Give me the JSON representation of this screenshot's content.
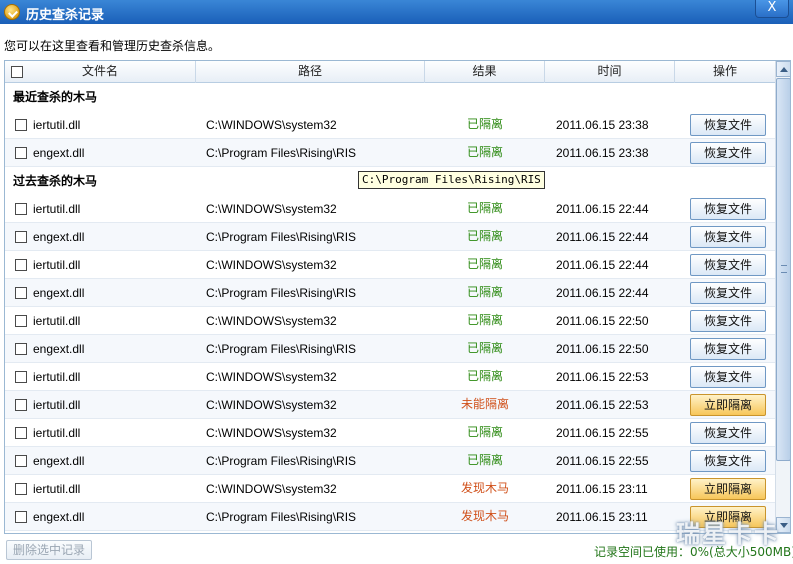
{
  "window": {
    "title": "历史查杀记录",
    "close_label": "X"
  },
  "description": "您可以在这里查看和管理历史查杀信息。",
  "columns": {
    "name": "文件名",
    "path": "路径",
    "result": "结果",
    "time": "时间",
    "action": "操作"
  },
  "groups": [
    {
      "label": "最近查杀的木马",
      "rows": [
        {
          "name": "iertutil.dll",
          "path": "C:\\WINDOWS\\system32",
          "result": "已隔离",
          "result_type": "ok",
          "time": "2011.06.15 23:38",
          "action": "恢复文件",
          "action_type": "restore"
        },
        {
          "name": "engext.dll",
          "path": "C:\\Program Files\\Rising\\RIS",
          "result": "已隔离",
          "result_type": "ok",
          "time": "2011.06.15 23:38",
          "action": "恢复文件",
          "action_type": "restore"
        }
      ]
    },
    {
      "label": "过去查杀的木马",
      "rows": [
        {
          "name": "iertutil.dll",
          "path": "C:\\WINDOWS\\system32",
          "result": "已隔离",
          "result_type": "ok",
          "time": "2011.06.15 22:44",
          "action": "恢复文件",
          "action_type": "restore"
        },
        {
          "name": "engext.dll",
          "path": "C:\\Program Files\\Rising\\RIS",
          "result": "已隔离",
          "result_type": "ok",
          "time": "2011.06.15 22:44",
          "action": "恢复文件",
          "action_type": "restore"
        },
        {
          "name": "iertutil.dll",
          "path": "C:\\WINDOWS\\system32",
          "result": "已隔离",
          "result_type": "ok",
          "time": "2011.06.15 22:44",
          "action": "恢复文件",
          "action_type": "restore"
        },
        {
          "name": "engext.dll",
          "path": "C:\\Program Files\\Rising\\RIS",
          "result": "已隔离",
          "result_type": "ok",
          "time": "2011.06.15 22:44",
          "action": "恢复文件",
          "action_type": "restore"
        },
        {
          "name": "iertutil.dll",
          "path": "C:\\WINDOWS\\system32",
          "result": "已隔离",
          "result_type": "ok",
          "time": "2011.06.15 22:50",
          "action": "恢复文件",
          "action_type": "restore"
        },
        {
          "name": "engext.dll",
          "path": "C:\\Program Files\\Rising\\RIS",
          "result": "已隔离",
          "result_type": "ok",
          "time": "2011.06.15 22:50",
          "action": "恢复文件",
          "action_type": "restore"
        },
        {
          "name": "iertutil.dll",
          "path": "C:\\WINDOWS\\system32",
          "result": "已隔离",
          "result_type": "ok",
          "time": "2011.06.15 22:53",
          "action": "恢复文件",
          "action_type": "restore"
        },
        {
          "name": "iertutil.dll",
          "path": "C:\\WINDOWS\\system32",
          "result": "未能隔离",
          "result_type": "warn",
          "time": "2011.06.15 22:53",
          "action": "立即隔离",
          "action_type": "isolate"
        },
        {
          "name": "iertutil.dll",
          "path": "C:\\WINDOWS\\system32",
          "result": "已隔离",
          "result_type": "ok",
          "time": "2011.06.15 22:55",
          "action": "恢复文件",
          "action_type": "restore"
        },
        {
          "name": "engext.dll",
          "path": "C:\\Program Files\\Rising\\RIS",
          "result": "已隔离",
          "result_type": "ok",
          "time": "2011.06.15 22:55",
          "action": "恢复文件",
          "action_type": "restore"
        },
        {
          "name": "iertutil.dll",
          "path": "C:\\WINDOWS\\system32",
          "result": "发现木马",
          "result_type": "warn",
          "time": "2011.06.15 23:11",
          "action": "立即隔离",
          "action_type": "isolate"
        },
        {
          "name": "engext.dll",
          "path": "C:\\Program Files\\Rising\\RIS",
          "result": "发现木马",
          "result_type": "warn",
          "time": "2011.06.15 23:11",
          "action": "立即隔离",
          "action_type": "isolate"
        }
      ]
    }
  ],
  "tooltip": "C:\\Program Files\\Rising\\RIS",
  "footer": {
    "delete_label": "删除选中记录",
    "status": "记录空间已使用：0%(总大小500MB)"
  },
  "watermark": "瑞星卡卡",
  "colors": {
    "title_bar": "#1a5fb8",
    "ok": "#2c8a12",
    "warn": "#d0501a",
    "isolate_button": "#f7c65a"
  }
}
